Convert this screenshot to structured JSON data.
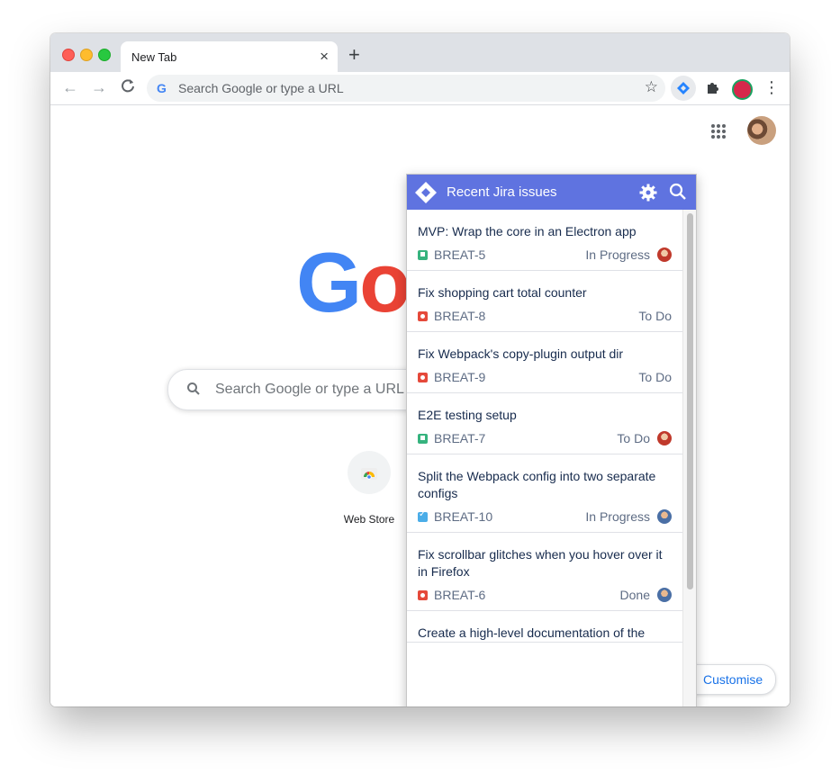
{
  "browser": {
    "tab_title": "New Tab",
    "tab_close": "×",
    "new_tab": "+",
    "omnibox_g": "G",
    "omnibox_placeholder": "Search Google or type a URL",
    "nav": {
      "back": "←",
      "forward": "→",
      "reload": "C"
    },
    "star": "☆",
    "menu": "⋮"
  },
  "new_tab_page": {
    "logo_letters": [
      "G",
      "o"
    ],
    "search_placeholder": "Search Google or type a URL",
    "shortcut_label": "Web Store",
    "customise_label": "Customise"
  },
  "jira_popup": {
    "title": "Recent Jira issues",
    "issues": [
      {
        "title": "MVP: Wrap the core in an Electron app",
        "key": "BREAT-5",
        "type": "story",
        "status": "In Progress",
        "assignee": true
      },
      {
        "title": "Fix shopping cart total counter",
        "key": "BREAT-8",
        "type": "bug",
        "status": "To Do",
        "assignee": false
      },
      {
        "title": "Fix Webpack's copy-plugin output dir",
        "key": "BREAT-9",
        "type": "bug",
        "status": "To Do",
        "assignee": false
      },
      {
        "title": "E2E testing setup",
        "key": "BREAT-7",
        "type": "story",
        "status": "To Do",
        "assignee": true
      },
      {
        "title": "Split the Webpack config into two separate configs",
        "key": "BREAT-10",
        "type": "task",
        "status": "In Progress",
        "assignee": true
      },
      {
        "title": "Fix scrollbar glitches when you hover over it in Firefox",
        "key": "BREAT-6",
        "type": "bug",
        "status": "Done",
        "assignee": true
      },
      {
        "title": "Create a high-level documentation of the",
        "key": "",
        "type": "",
        "status": "",
        "assignee": false
      }
    ]
  },
  "colors": {
    "jira_header": "#5f73e0",
    "story": "#36b37e",
    "bug": "#e5493a",
    "task": "#4bade8",
    "link_blue": "#1a73e8"
  }
}
